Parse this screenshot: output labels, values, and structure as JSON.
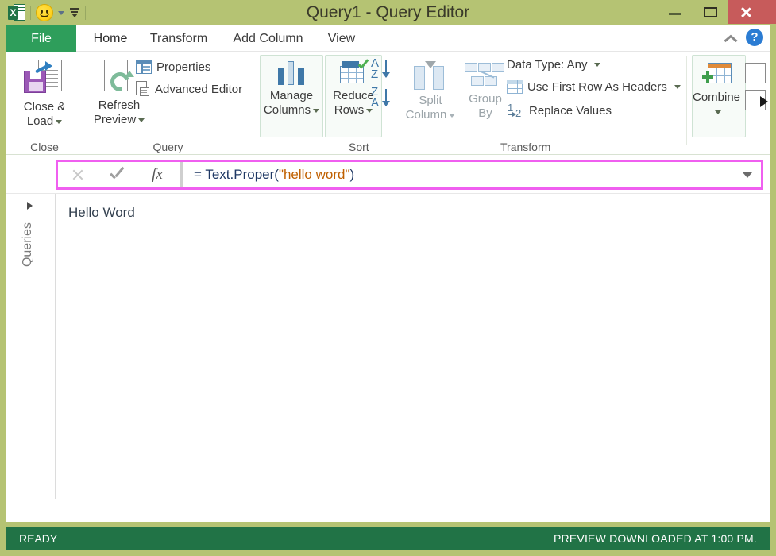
{
  "window": {
    "title": "Query1 - Query Editor",
    "colors": {
      "frame": "#b5c373",
      "file_tab": "#2e9e5b",
      "status_bar": "#217346",
      "close_button": "#c75b5b",
      "formula_highlight": "#f05ff0",
      "help_blue": "#2b7cd3"
    },
    "quick_access": [
      {
        "name": "excel-icon",
        "label": "X"
      },
      {
        "name": "smiley-icon",
        "label": ""
      },
      {
        "name": "customize-qat-icon",
        "label": ""
      }
    ],
    "controls": {
      "minimize": "–",
      "maximize": "☐",
      "close": "✕"
    }
  },
  "ribbon": {
    "tabs": [
      {
        "label": "File",
        "active": false,
        "file": true
      },
      {
        "label": "Home",
        "active": true,
        "file": false
      },
      {
        "label": "Transform",
        "active": false,
        "file": false
      },
      {
        "label": "Add Column",
        "active": false,
        "file": false
      },
      {
        "label": "View",
        "active": false,
        "file": false
      }
    ],
    "collapse_icon": "chevron-up-icon",
    "help_label": "?",
    "groups": [
      {
        "label": "Close"
      },
      {
        "label": "Query"
      },
      {
        "label": "Sort"
      },
      {
        "label": "Transform"
      }
    ],
    "buttons": {
      "close_and_load_line1": "Close &",
      "close_and_load_line2": "Load",
      "refresh_preview_line1": "Refresh",
      "refresh_preview_line2": "Preview",
      "properties": "Properties",
      "advanced_editor": "Advanced Editor",
      "manage_columns_line1": "Manage",
      "manage_columns_line2": "Columns",
      "reduce_rows_line1": "Reduce",
      "reduce_rows_line2": "Rows",
      "sort_asc": "A\nZ",
      "sort_desc": "Z\nA",
      "split_column_line1": "Split",
      "split_column_line2": "Column",
      "group_by_line1": "Group",
      "group_by_line2": "By",
      "data_type": "Data Type: Any",
      "use_first_row": "Use First Row As Headers",
      "replace_values": "Replace Values",
      "combine": "Combine"
    },
    "sort_letters": {
      "asc_top": "A",
      "asc_bottom": "Z",
      "desc_top": "Z",
      "desc_bottom": "A"
    },
    "scroll_right_icon": "triangle-right-icon"
  },
  "formula_bar": {
    "cancel_icon": "cancel-icon",
    "accept_icon": "checkmark-icon",
    "fx_label": "fx",
    "formula_prefix": "= Text.Proper(",
    "formula_string": "\"hello word\"",
    "formula_suffix": ")",
    "formula_full": "= Text.Proper(\"hello word\")",
    "dropdown_icon": "chevron-down-icon"
  },
  "queries_pane": {
    "label": "Queries",
    "expand_icon": "triangle-right-icon"
  },
  "preview": {
    "value": "Hello Word"
  },
  "status_bar": {
    "left": "READY",
    "right": "PREVIEW DOWNLOADED AT 1:00 PM."
  }
}
